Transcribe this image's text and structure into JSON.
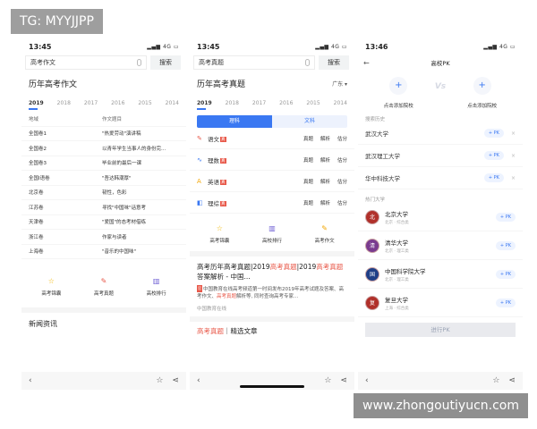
{
  "tg_badge": "TG: MYYJJPP",
  "watermark": "www.zhongoutiyucn.com",
  "status_icons": "▂▄▆ 4G ▭",
  "bottom_icons": {
    "back": "‹",
    "star": "☆",
    "share": "⋖"
  },
  "phone1": {
    "time": "13:45",
    "query": "高考作文",
    "search_label": "搜索",
    "section_title": "历年高考作文",
    "years": [
      "2019",
      "2018",
      "2017",
      "2016",
      "2015",
      "2014"
    ],
    "table_header": [
      "地域",
      "作文题目"
    ],
    "rows": [
      [
        "全国卷1",
        "\"热爱劳动\"演讲稿"
      ],
      [
        "全国卷2",
        "以青年学生当事人的身份完..."
      ],
      [
        "全国卷3",
        "毕业前的最后一课"
      ],
      [
        "全国I语卷",
        "\"吾达韩潮厚\""
      ],
      [
        "北京卷",
        "韧性，色彩"
      ],
      [
        "江苏卷",
        "寻找\"中国味\"话意考"
      ],
      [
        "天津卷",
        "\"爱国\"的态考材借练"
      ],
      [
        "浙江卷",
        "作家与读者"
      ],
      [
        "上海卷",
        "\"音乐的中国味\""
      ]
    ],
    "quicklinks": [
      {
        "icon": "☆",
        "label": "高考锦囊"
      },
      {
        "icon": "✎",
        "label": "高考真题"
      },
      {
        "icon": "▥",
        "label": "高校排行"
      }
    ],
    "news_title": "新闻资讯"
  },
  "phone2": {
    "time": "13:45",
    "query": "高考真题",
    "search_label": "搜索",
    "section_title": "历年高考真题",
    "province": "广东 ▾",
    "years": [
      "2019",
      "2018",
      "2017",
      "2016",
      "2015",
      "2014"
    ],
    "seg_on": "理科",
    "seg_off": "文科",
    "subjects": [
      {
        "icon": "✎",
        "name": "语文",
        "tag": "真",
        "actions": [
          "真题",
          "解析",
          "估分"
        ]
      },
      {
        "icon": "∿",
        "name": "理数",
        "tag": "真",
        "actions": [
          "真题",
          "解析",
          "估分"
        ]
      },
      {
        "icon": "A",
        "name": "英语",
        "tag": "真",
        "actions": [
          "真题",
          "解析",
          "估分"
        ]
      },
      {
        "icon": "◧",
        "name": "理综",
        "tag": "真",
        "actions": [
          "真题",
          "解析",
          "估分"
        ]
      }
    ],
    "quicklinks": [
      {
        "icon": "☆",
        "label": "高考锦囊"
      },
      {
        "icon": "▥",
        "label": "高校排行"
      },
      {
        "icon": "✎",
        "label": "高考作文"
      }
    ],
    "result": {
      "title_a": "高考历年高考真题|2019",
      "title_hl1": "高考真题",
      "title_b": "|2019",
      "title_hl2": "高考真题",
      "title_c": "答案解析 - 中国...",
      "snippet_tag": "官",
      "snippet_a": "中国教育在线高考频道第一时间发布2019年高考试题及答案、高考作文、",
      "snippet_hl": "高考真题",
      "snippet_b": "解析等, 同时查询高考专家...",
      "source": "中国教育在线"
    },
    "result2_hl": "高考真题",
    "result2_rest": "｜精选文章"
  },
  "phone3": {
    "time": "13:46",
    "back": "←",
    "title": "高校PK",
    "slot_icon": "+",
    "slot_label": "点击添加院校",
    "vs": "Vs",
    "history_label": "搜索历史",
    "pk_label": "+ PK",
    "remove": "×",
    "history": [
      "武汉大学",
      "武汉理工大学",
      "华中科技大学"
    ],
    "hot_label": "热门大学",
    "hot": [
      {
        "name": "北京大学",
        "sub": "北京 · 综合类",
        "logo": "北",
        "color": "#b0302a"
      },
      {
        "name": "清华大学",
        "sub": "北京 · 理工类",
        "logo": "清",
        "color": "#7a3b8f"
      },
      {
        "name": "中国科学院大学",
        "sub": "北京 · 理工类",
        "logo": "国",
        "color": "#1f3f87"
      },
      {
        "name": "复旦大学",
        "sub": "上海 · 综合类",
        "logo": "复",
        "color": "#b0302a"
      }
    ],
    "start_pk": "进行PK"
  }
}
